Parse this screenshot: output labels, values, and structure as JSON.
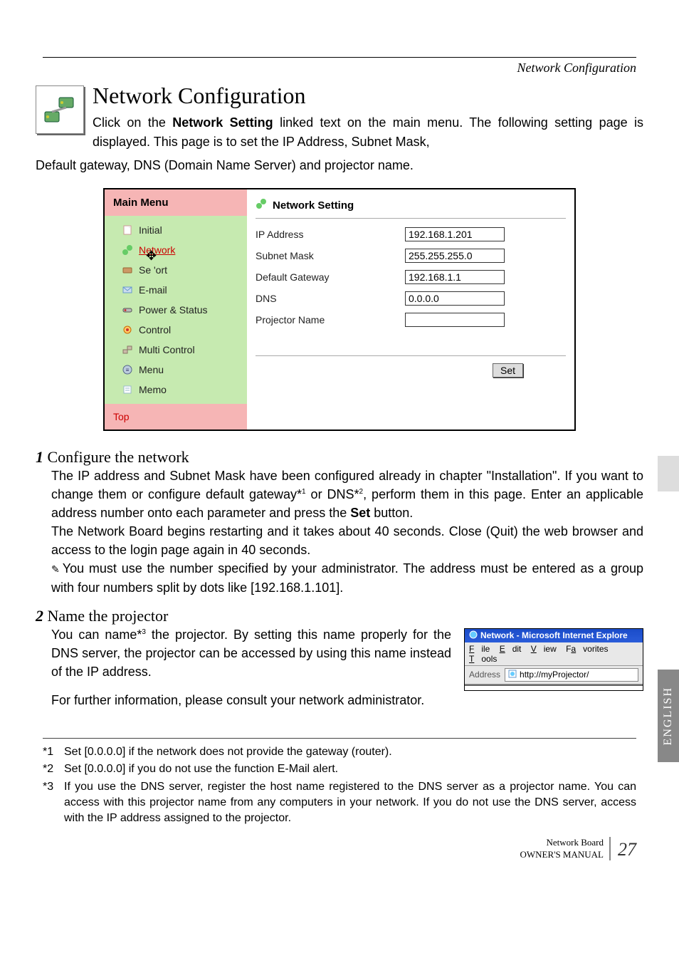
{
  "header": {
    "running_title": "Network Configuration"
  },
  "title": "Network Configuration",
  "intro_inline": "Click on the ",
  "intro_bold": "Network Setting",
  "intro_after": " linked text on the main menu. The following setting page is displayed. This page is to set the IP Address, Subnet Mask,",
  "intro_cont": "Default gateway, DNS (Domain Name Server) and projector name.",
  "app": {
    "sidebar_title": "Main Menu",
    "items": [
      {
        "label": "Initial",
        "link": false
      },
      {
        "label": "Network",
        "link": true,
        "has_cursor": true
      },
      {
        "label": "Se      'ort",
        "link": false
      },
      {
        "label": "E-mail",
        "link": false
      },
      {
        "label": "Power & Status",
        "link": false
      },
      {
        "label": "Control",
        "link": false
      },
      {
        "label": "Multi Control",
        "link": false
      },
      {
        "label": "Menu",
        "link": false
      },
      {
        "label": "Memo",
        "link": false
      }
    ],
    "bottom_link": "Top",
    "content_title": "Network Setting",
    "fields": [
      {
        "label": "IP Address",
        "value": "192.168.1.201"
      },
      {
        "label": "Subnet Mask",
        "value": "255.255.255.0"
      },
      {
        "label": "Default Gateway",
        "value": "192.168.1.1"
      },
      {
        "label": "DNS",
        "value": "0.0.0.0"
      },
      {
        "label": "Projector Name",
        "value": ""
      }
    ],
    "set_button": "Set"
  },
  "step1": {
    "num": "1",
    "title": " Configure the network",
    "p1a": "The IP address and Subnet Mask have been configured already in chapter \"Installation\". If you want to change them or configure default gateway*",
    "p1_sup1": "1",
    "p1b": " or DNS*",
    "p1_sup2": "2",
    "p1c": ", perform them in this page. Enter an applicable address number onto each parameter and press the ",
    "p1_bold": "Set",
    "p1d": " button.",
    "p2": "The Network Board begins restarting and it takes about 40 seconds. Close (Quit) the web browser and access to the login page again in 40 seconds.",
    "note": "You must use the number specified by your administrator. The address must be entered as a group with four numbers split by dots like [192.168.1.101]."
  },
  "step2": {
    "num": "2",
    "title": " Name the projector",
    "p1a": "You can name*",
    "p1_sup": "3",
    "p1b": " the projector. By setting this name properly for the DNS server, the projector can be accessed by using this name instead of the IP address.",
    "p2": "For further information, please consult your network administrator."
  },
  "browser": {
    "title": "Network - Microsoft Internet Explore",
    "menu": {
      "file": "File",
      "edit": "Edit",
      "view": "View",
      "fav": "Favorites",
      "tools": "Tools"
    },
    "addr_label": "Address",
    "url": "http://myProjector/"
  },
  "footnotes": {
    "f1": {
      "m": "*1",
      "t": "Set [0.0.0.0] if the network does not provide the gateway (router)."
    },
    "f2": {
      "m": "*2",
      "t": "Set [0.0.0.0] if you do not use the function E-Mail alert."
    },
    "f3": {
      "m": "*3",
      "t": "If you use the DNS server, register the host name registered to the DNS server as a projector name. You can access with this projector name from any computers in your network. If you do not use the DNS server, access with the IP address assigned to the projector."
    }
  },
  "footer": {
    "line1": "Network Board",
    "line2": "OWNER'S MANUAL",
    "page": "27"
  },
  "side_tab": "ENGLISH"
}
